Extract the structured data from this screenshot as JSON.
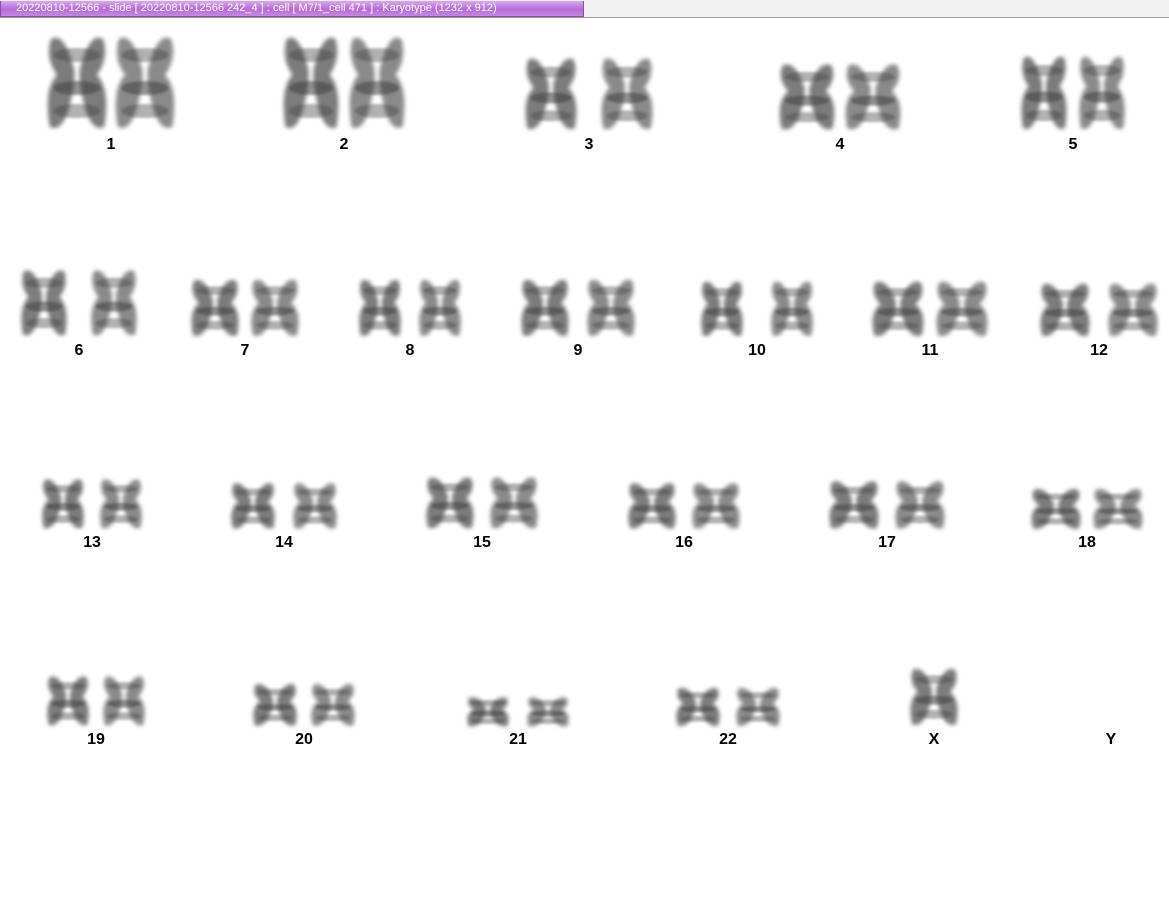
{
  "window": {
    "title": "20220810-12566 - slide [ 20220810-12566 242_4 ] : cell [ M7/1_cell 471 ] : Karyotype  (1232 x 912)"
  },
  "karyotype": {
    "chromosomes": [
      {
        "label": "1",
        "count": 2
      },
      {
        "label": "2",
        "count": 2
      },
      {
        "label": "3",
        "count": 2
      },
      {
        "label": "4",
        "count": 2
      },
      {
        "label": "5",
        "count": 2
      },
      {
        "label": "6",
        "count": 2
      },
      {
        "label": "7",
        "count": 2
      },
      {
        "label": "8",
        "count": 2
      },
      {
        "label": "9",
        "count": 2
      },
      {
        "label": "10",
        "count": 2
      },
      {
        "label": "11",
        "count": 2
      },
      {
        "label": "12",
        "count": 2
      },
      {
        "label": "13",
        "count": 2
      },
      {
        "label": "14",
        "count": 2
      },
      {
        "label": "15",
        "count": 2
      },
      {
        "label": "16",
        "count": 2
      },
      {
        "label": "17",
        "count": 2
      },
      {
        "label": "18",
        "count": 2
      },
      {
        "label": "19",
        "count": 2
      },
      {
        "label": "20",
        "count": 2
      },
      {
        "label": "21",
        "count": 2
      },
      {
        "label": "22",
        "count": 2
      },
      {
        "label": "X",
        "count": 1
      },
      {
        "label": "Y",
        "count": 0
      }
    ]
  }
}
